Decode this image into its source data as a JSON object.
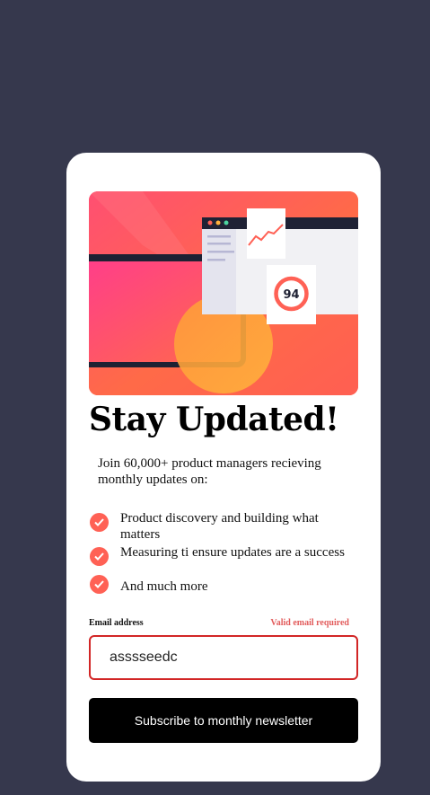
{
  "colors": {
    "background": "#36384d",
    "card": "#ffffff",
    "accent": "#ff6155",
    "error": "#d22626",
    "button": "#000000"
  },
  "hero": {
    "score": "94",
    "icon": "dashboard-illustration"
  },
  "heading": "Stay Updated!",
  "intro": "Join 60,000+ product managers recieving monthly updates on:",
  "features": [
    {
      "icon": "check-icon",
      "text": "Product discovery and building what matters"
    },
    {
      "icon": "check-icon",
      "text": "Measuring ti ensure updates are a success"
    },
    {
      "icon": "check-icon",
      "text": "And much more"
    }
  ],
  "form": {
    "email_label": "Email address",
    "error_message": "Valid email required",
    "email_value": "asssseedc",
    "submit_label": "Subscribe to monthly newsletter"
  }
}
